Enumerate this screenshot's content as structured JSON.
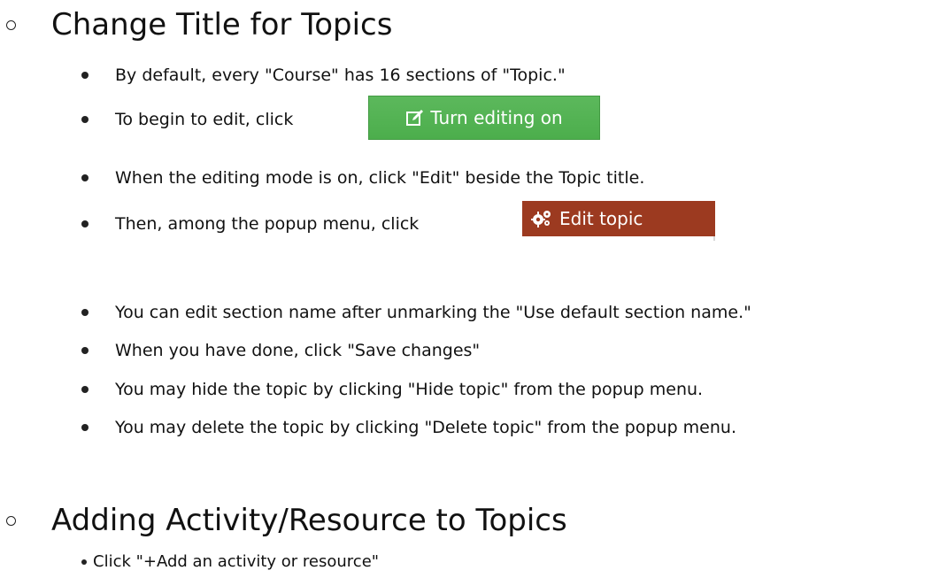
{
  "sections": [
    {
      "title": "Change Title for Topics",
      "items": [
        "By default, every \"Course\" has 16 sections of \"Topic.\"",
        "To begin to edit, click",
        "When the editing mode is on, click \"Edit\" beside the Topic title.",
        "Then, among the popup menu, click",
        "You can edit section name after unmarking the \"Use default section name.\"",
        "When you have done, click \"Save changes\"",
        "You may hide the topic by clicking \"Hide topic\" from the popup menu.",
        "You may delete the topic by clicking \"Delete topic\" from the popup menu."
      ]
    },
    {
      "title": "Adding Activity/Resource to Topics",
      "items": [
        "Click \"+Add an activity or resource\""
      ]
    }
  ],
  "buttons": {
    "turn_editing_on": {
      "label": "Turn editing on",
      "icon": "pencil-square-icon",
      "color": "#5cb85c"
    },
    "edit_topic": {
      "label": "Edit topic",
      "icon": "cogs-icon",
      "color": "#9c3a20"
    }
  }
}
